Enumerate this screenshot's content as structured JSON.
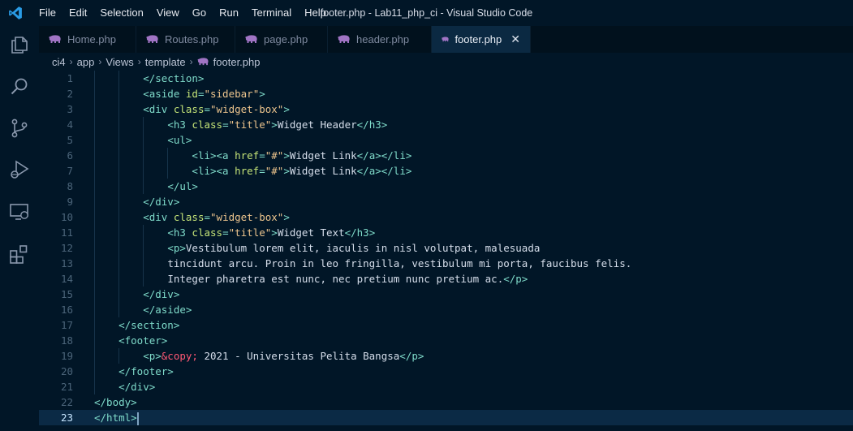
{
  "window": {
    "title": "footer.php - Lab11_php_ci - Visual Studio Code"
  },
  "menu": [
    "File",
    "Edit",
    "Selection",
    "View",
    "Go",
    "Run",
    "Terminal",
    "Help"
  ],
  "activity_bar": [
    "explorer-icon",
    "search-icon",
    "source-control-icon",
    "run-debug-icon",
    "remote-explorer-icon",
    "extensions-icon"
  ],
  "tabs": [
    {
      "label": "Home.php",
      "active": false
    },
    {
      "label": "Routes.php",
      "active": false
    },
    {
      "label": "page.php",
      "active": false
    },
    {
      "label": "header.php",
      "active": false
    },
    {
      "label": "footer.php",
      "active": true
    }
  ],
  "tab_close_glyph": "✕",
  "breadcrumb": [
    "ci4",
    "app",
    "Views",
    "template",
    "footer.php"
  ],
  "editor": {
    "current_line": 23,
    "lines": [
      {
        "n": "1",
        "indent": 2,
        "tokens": [
          [
            "t",
            "</section>"
          ]
        ]
      },
      {
        "n": "2",
        "indent": 2,
        "tokens": [
          [
            "t",
            "<aside "
          ],
          [
            "at",
            "id"
          ],
          [
            "eq",
            "="
          ],
          [
            "s",
            "\"sidebar\""
          ],
          [
            "t",
            ">"
          ]
        ]
      },
      {
        "n": "3",
        "indent": 2,
        "tokens": [
          [
            "t",
            "<div "
          ],
          [
            "at",
            "class"
          ],
          [
            "eq",
            "="
          ],
          [
            "s",
            "\"widget-box\""
          ],
          [
            "t",
            ">"
          ]
        ]
      },
      {
        "n": "4",
        "indent": 3,
        "tokens": [
          [
            "t",
            "<h3 "
          ],
          [
            "at",
            "class"
          ],
          [
            "eq",
            "="
          ],
          [
            "s",
            "\"title\""
          ],
          [
            "t",
            ">"
          ],
          [
            "txt",
            "Widget Header"
          ],
          [
            "t",
            "</h3>"
          ]
        ]
      },
      {
        "n": "5",
        "indent": 3,
        "tokens": [
          [
            "t",
            "<ul>"
          ]
        ]
      },
      {
        "n": "6",
        "indent": 4,
        "tokens": [
          [
            "t",
            "<li><a "
          ],
          [
            "at",
            "href"
          ],
          [
            "eq",
            "="
          ],
          [
            "s",
            "\"#\""
          ],
          [
            "t",
            ">"
          ],
          [
            "txt",
            "Widget Link"
          ],
          [
            "t",
            "</a></li>"
          ]
        ]
      },
      {
        "n": "7",
        "indent": 4,
        "tokens": [
          [
            "t",
            "<li><a "
          ],
          [
            "at",
            "href"
          ],
          [
            "eq",
            "="
          ],
          [
            "s",
            "\"#\""
          ],
          [
            "t",
            ">"
          ],
          [
            "txt",
            "Widget Link"
          ],
          [
            "t",
            "</a></li>"
          ]
        ]
      },
      {
        "n": "8",
        "indent": 3,
        "tokens": [
          [
            "t",
            "</ul>"
          ]
        ]
      },
      {
        "n": "9",
        "indent": 2,
        "tokens": [
          [
            "t",
            "</div>"
          ]
        ]
      },
      {
        "n": "10",
        "indent": 2,
        "tokens": [
          [
            "t",
            "<div "
          ],
          [
            "at",
            "class"
          ],
          [
            "eq",
            "="
          ],
          [
            "s",
            "\"widget-box\""
          ],
          [
            "t",
            ">"
          ]
        ]
      },
      {
        "n": "11",
        "indent": 3,
        "tokens": [
          [
            "t",
            "<h3 "
          ],
          [
            "at",
            "class"
          ],
          [
            "eq",
            "="
          ],
          [
            "s",
            "\"title\""
          ],
          [
            "t",
            ">"
          ],
          [
            "txt",
            "Widget Text"
          ],
          [
            "t",
            "</h3>"
          ]
        ]
      },
      {
        "n": "12",
        "indent": 3,
        "tokens": [
          [
            "t",
            "<p>"
          ],
          [
            "txt",
            "Vestibulum lorem elit, iaculis in nisl volutpat, malesuada"
          ]
        ]
      },
      {
        "n": "13",
        "indent": 3,
        "tokens": [
          [
            "txt",
            "tincidunt arcu. Proin in leo fringilla, vestibulum mi porta, faucibus felis."
          ]
        ]
      },
      {
        "n": "14",
        "indent": 3,
        "tokens": [
          [
            "txt",
            "Integer pharetra est nunc, nec pretium nunc pretium ac."
          ],
          [
            "t",
            "</p>"
          ]
        ]
      },
      {
        "n": "15",
        "indent": 2,
        "tokens": [
          [
            "t",
            "</div>"
          ]
        ]
      },
      {
        "n": "16",
        "indent": 2,
        "tokens": [
          [
            "t",
            "</aside>"
          ]
        ]
      },
      {
        "n": "17",
        "indent": 1,
        "tokens": [
          [
            "t",
            "</section>"
          ]
        ]
      },
      {
        "n": "18",
        "indent": 1,
        "tokens": [
          [
            "t",
            "<footer>"
          ]
        ]
      },
      {
        "n": "19",
        "indent": 2,
        "tokens": [
          [
            "t",
            "<p>"
          ],
          [
            "ent",
            "&copy;"
          ],
          [
            "txt",
            " 2021 - Universitas Pelita Bangsa"
          ],
          [
            "t",
            "</p>"
          ]
        ]
      },
      {
        "n": "20",
        "indent": 1,
        "tokens": [
          [
            "t",
            "</footer>"
          ]
        ]
      },
      {
        "n": "21",
        "indent": 1,
        "tokens": [
          [
            "t",
            "</div>"
          ]
        ]
      },
      {
        "n": "22",
        "indent": 0,
        "tokens": [
          [
            "t",
            "</body>"
          ]
        ]
      },
      {
        "n": "23",
        "indent": 0,
        "tokens": [
          [
            "t",
            "</html>"
          ]
        ]
      }
    ]
  },
  "colors": {
    "background": "#011627",
    "tag": "#7fdbca",
    "attribute": "#c5e478",
    "string": "#ecc48d",
    "entity": "#ff5874",
    "text": "#d6deeb",
    "php_icon": "#a074c4",
    "vscode_blue": "#2a9ce6"
  }
}
